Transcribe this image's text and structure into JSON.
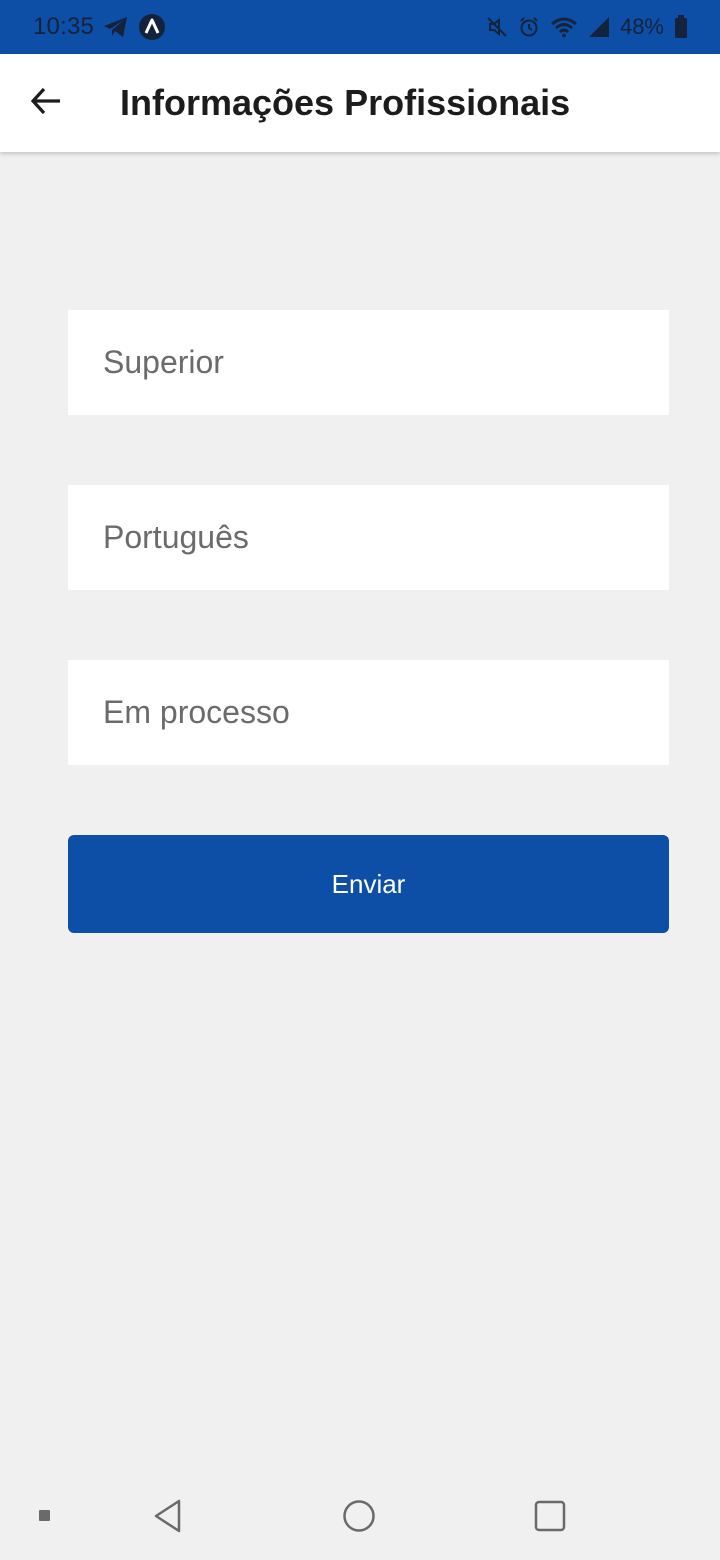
{
  "status_bar": {
    "time": "10:35",
    "battery": "48%",
    "background": "#0d4fa6",
    "icons": [
      "telegram-icon",
      "app-notification-icon",
      "mute-icon",
      "alarm-icon",
      "wifi-icon",
      "signal-icon",
      "battery-icon"
    ]
  },
  "app_bar": {
    "title": "Informações Profissionais",
    "back_icon": "arrow-left-icon"
  },
  "form": {
    "fields": [
      {
        "value": "Superior"
      },
      {
        "value": "Português"
      },
      {
        "value": "Em processo"
      }
    ],
    "submit_label": "Enviar",
    "accent": "#0d4fa6"
  },
  "nav_bar": {
    "icons": [
      "menu-dot-icon",
      "back-triangle-icon",
      "home-circle-icon",
      "recents-square-icon"
    ]
  }
}
